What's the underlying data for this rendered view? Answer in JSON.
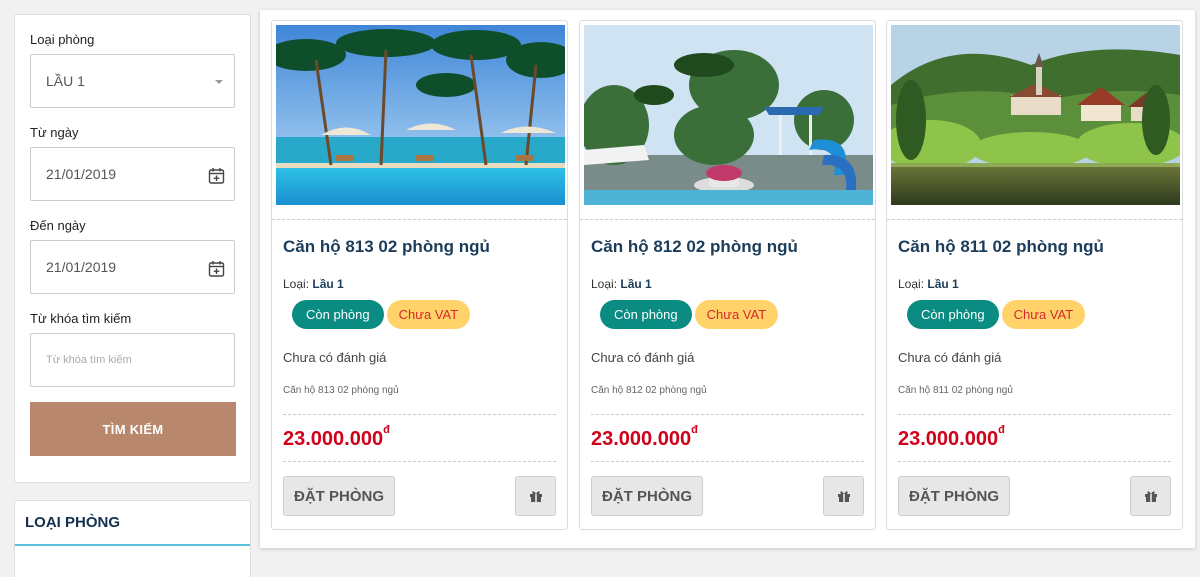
{
  "search": {
    "room_type_label": "Loại phòng",
    "room_type_value": "LẦU 1",
    "from_label": "Từ ngày",
    "from_value": "21/01/2019",
    "to_label": "Đến ngày",
    "to_value": "21/01/2019",
    "keyword_label": "Từ khóa tìm kiếm",
    "keyword_placeholder": "Từ khóa tìm kiếm",
    "search_button": "TÌM KIẾM"
  },
  "room_types": {
    "title": "LOẠI PHÒNG"
  },
  "colors": {
    "accent_brown": "#b9876c",
    "badge_green": "#0b8c83",
    "badge_yellow": "#ffd36a",
    "price_red": "#d0021b",
    "title_navy": "#1c3d5a"
  },
  "cards": [
    {
      "title": "Căn hộ 813 02 phòng ngủ",
      "type_prefix": "Loại:",
      "type_value": "Lầu 1",
      "badge_available": "Còn phòng",
      "badge_vat": "Chưa VAT",
      "rating": "Chưa có đánh giá",
      "description": "Căn hộ 813 02 phòng ngủ",
      "price": "23.000.000",
      "currency": "đ",
      "book_label": "ĐẶT PHÒNG",
      "image": "beach-pool"
    },
    {
      "title": "Căn hộ 812 02 phòng ngủ",
      "type_prefix": "Loại:",
      "type_value": "Lầu 1",
      "badge_available": "Còn phòng",
      "badge_vat": "Chưa VAT",
      "rating": "Chưa có đánh giá",
      "description": "Căn hộ 812 02 phòng ngủ",
      "price": "23.000.000",
      "currency": "đ",
      "book_label": "ĐẶT PHÒNG",
      "image": "water-park"
    },
    {
      "title": "Căn hộ 811 02 phòng ngủ",
      "type_prefix": "Loại:",
      "type_value": "Lầu 1",
      "badge_available": "Còn phòng",
      "badge_vat": "Chưa VAT",
      "rating": "Chưa có đánh giá",
      "description": "Căn hộ 811 02 phòng ngủ",
      "price": "23.000.000",
      "currency": "đ",
      "book_label": "ĐẶT PHÒNG",
      "image": "lake-village"
    }
  ]
}
